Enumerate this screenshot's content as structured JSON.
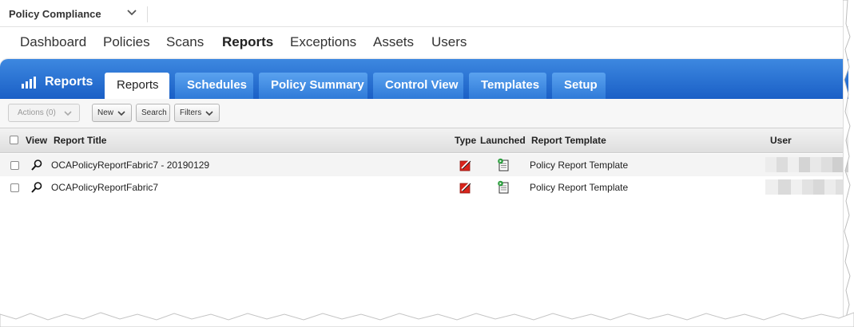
{
  "app": {
    "module_title": "Policy Compliance"
  },
  "nav": {
    "items": [
      "Dashboard",
      "Policies",
      "Scans",
      "Reports",
      "Exceptions",
      "Assets",
      "Users"
    ],
    "active": "Reports"
  },
  "reports_panel": {
    "logo_label": "Reports",
    "tabs": [
      "Reports",
      "Schedules",
      "Policy Summary",
      "Control View",
      "Templates",
      "Setup"
    ],
    "active_tab": "Reports"
  },
  "toolbar": {
    "actions_label": "Actions (0)",
    "new_label": "New",
    "search_label": "Search",
    "filters_label": "Filters"
  },
  "table": {
    "headers": {
      "view": "View",
      "title": "Report Title",
      "type": "Type",
      "launched": "Launched",
      "template": "Report Template",
      "user": "User"
    },
    "rows": [
      {
        "title": "OCAPolicyReportFabric7 - 20190129",
        "template": "Policy Report Template",
        "type_icon": "pdf-report-icon",
        "launched_icon": "launched-document-icon"
      },
      {
        "title": "OCAPolicyReportFabric7",
        "template": "Policy Report Template",
        "type_icon": "pdf-report-icon",
        "launched_icon": "launched-document-icon"
      }
    ]
  },
  "colors": {
    "tab_band_top": "#3d88e0",
    "tab_band_bottom": "#1a5fc6",
    "tab_inactive": "#3f8ae2",
    "accent_red": "#d9241b",
    "accent_green": "#2a9d3c"
  }
}
